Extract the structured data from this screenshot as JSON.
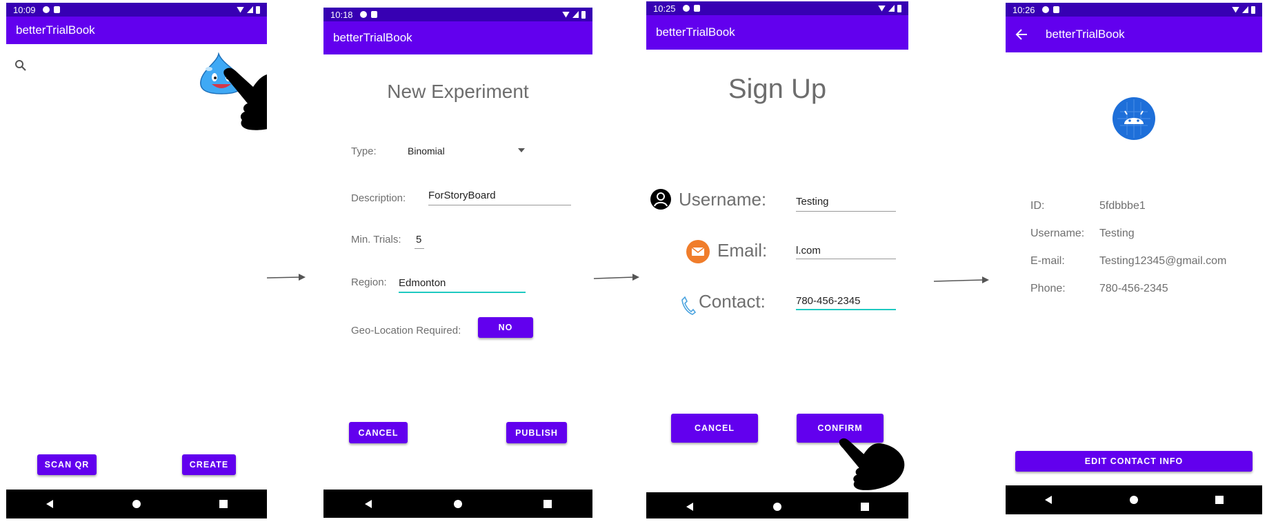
{
  "colors": {
    "primary": "#6200EE",
    "primary_dark": "#3700B3",
    "accent": "#1ec9c1",
    "navbar": "#000000"
  },
  "screens": [
    {
      "status_time": "10:09",
      "app_title": "betterTrialBook",
      "icons": [
        "search-icon",
        "slime-mascot",
        "pointing-hand-cursor"
      ],
      "buttons": {
        "scan": "SCAN QR",
        "create": "CREATE"
      }
    },
    {
      "status_time": "10:18",
      "app_title": "betterTrialBook",
      "heading": "New Experiment",
      "type_label": "Type:",
      "type_value": "Binomial",
      "description_label": "Description:",
      "description_value": "ForStoryBoard",
      "min_trials_label": "Min. Trials:",
      "min_trials_value": "5",
      "region_label": "Region:",
      "region_value": "Edmonton",
      "geo_label": "Geo-Location Required:",
      "geo_toggle": "NO",
      "buttons": {
        "cancel": "CANCEL",
        "publish": "PUBLISH"
      }
    },
    {
      "status_time": "10:25",
      "app_title": "betterTrialBook",
      "heading": "Sign Up",
      "username_label": "Username:",
      "username_value": "Testing",
      "email_label": "Email:",
      "email_value": "l.com",
      "contact_label": "Contact:",
      "contact_value": "780-456-2345",
      "buttons": {
        "cancel": "CANCEL",
        "confirm": "CONFIRM"
      }
    },
    {
      "status_time": "10:26",
      "app_title": "betterTrialBook",
      "id_label": "ID:",
      "id_value": "5fdbbbe1",
      "username_label": "Username:",
      "username_value": "Testing",
      "email_label": "E-mail:",
      "email_value": "Testing12345@gmail.com",
      "phone_label": "Phone:",
      "phone_value": "780-456-2345",
      "buttons": {
        "edit": "EDIT CONTACT INFO"
      }
    }
  ]
}
